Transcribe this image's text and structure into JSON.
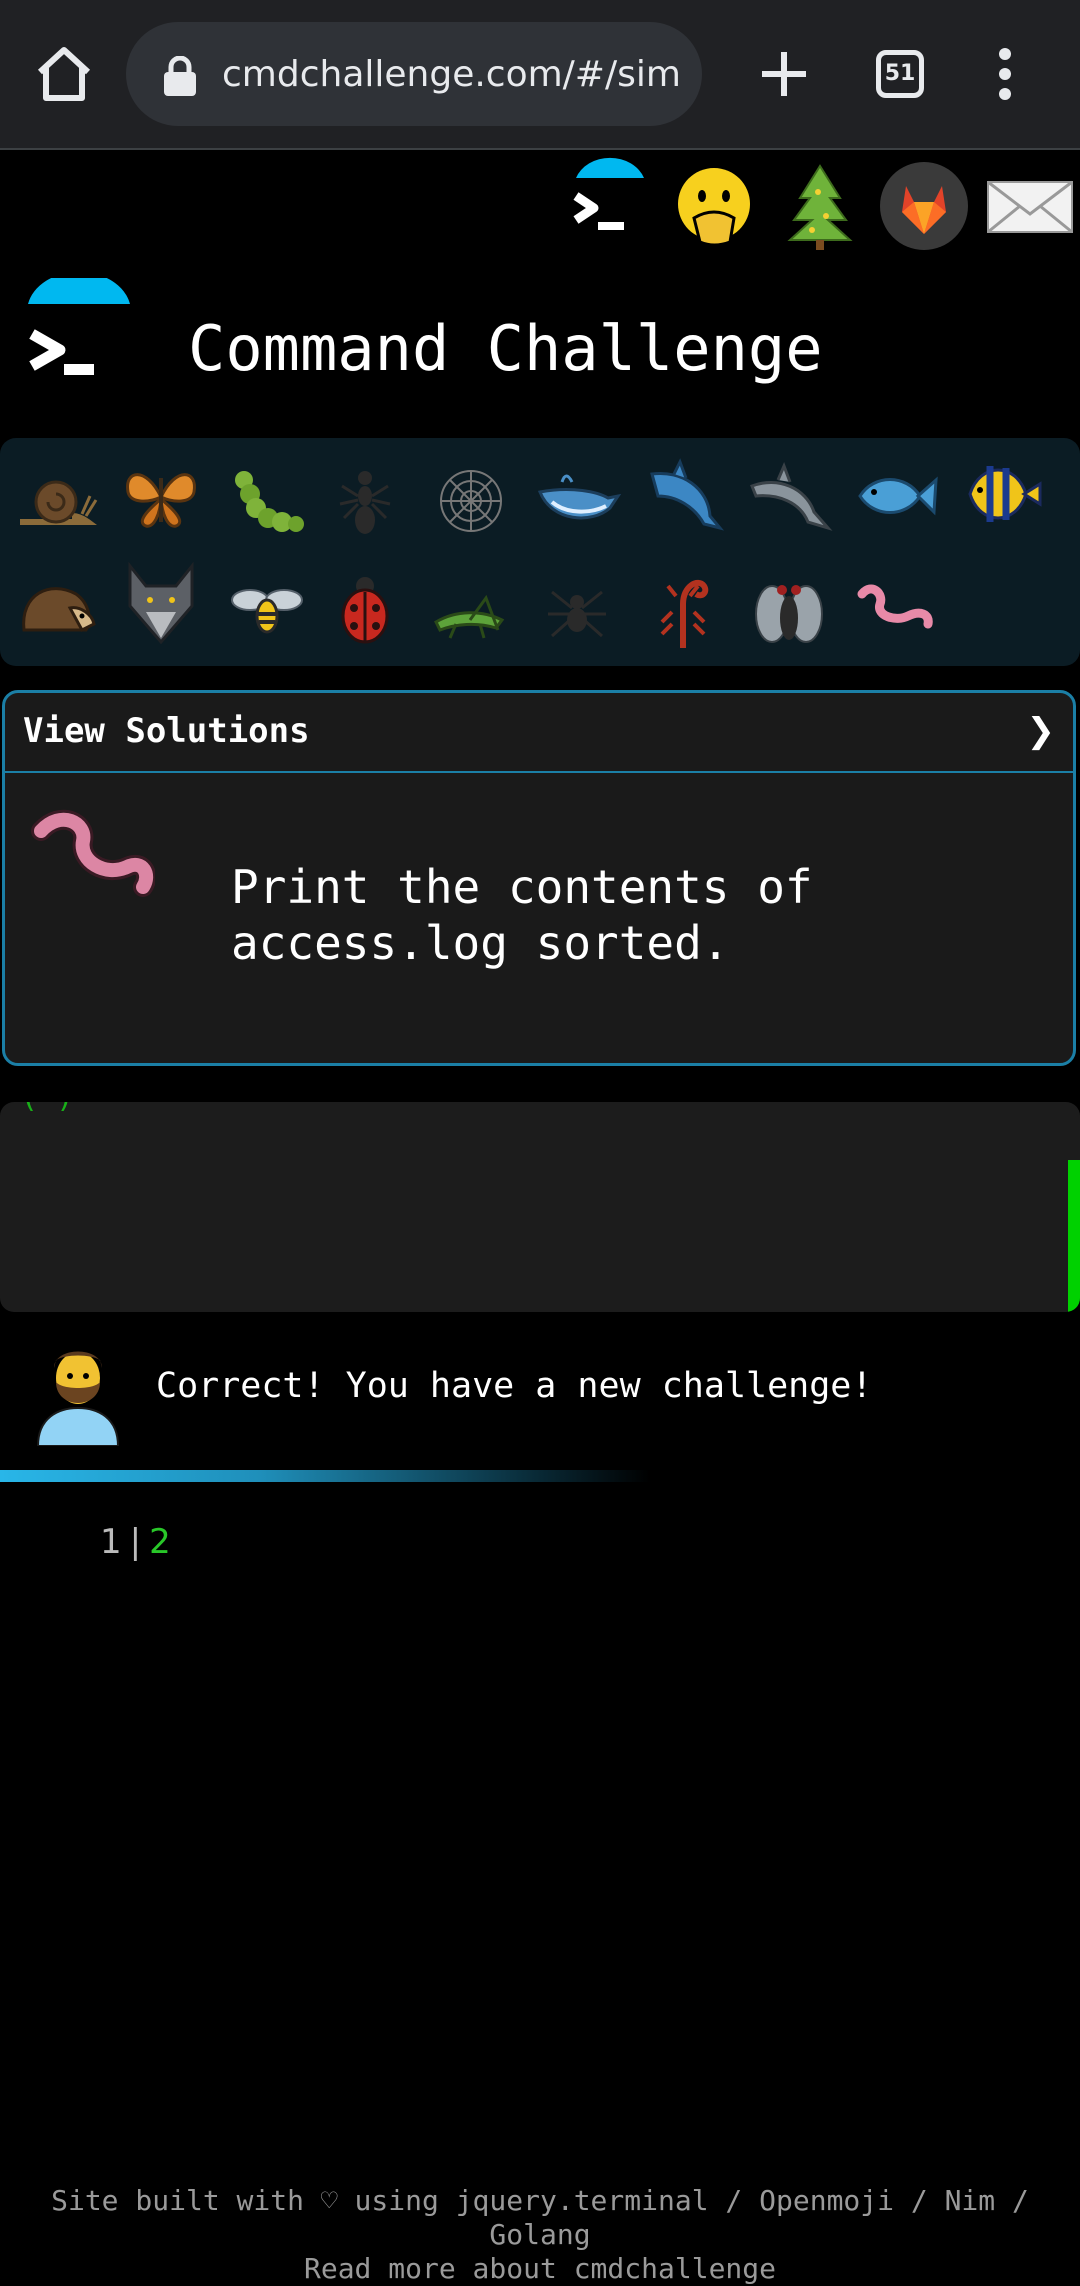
{
  "browser": {
    "url": "cmdchallenge.com/#/simp",
    "tab_count": "51"
  },
  "top_icons": [
    "terminal-icon",
    "face-with-hand-over-mouth-icon",
    "tree-icon",
    "gitlab-icon",
    "envelope-icon"
  ],
  "header": {
    "title": "Command Challenge"
  },
  "animals": {
    "row1": [
      "snail",
      "butterfly",
      "caterpillar",
      "ant",
      "spider-web",
      "whale",
      "dolphin-blue",
      "dolphin-gray",
      "fish",
      "tropical-fish"
    ],
    "row2": [
      "hedgehog",
      "wolf",
      "bee",
      "ladybug",
      "cricket",
      "spider",
      "scorpion",
      "fly",
      "worm"
    ]
  },
  "solutions": {
    "label": "View Solutions",
    "chevron": "❯",
    "challenge_text": "Print the contents of access.log sorted."
  },
  "feedback": {
    "message": "Correct! You have a new challenge!"
  },
  "level": {
    "previous": "1",
    "separator": "|",
    "current": "2"
  },
  "footer": {
    "line1_prefix": "Site built with ♡ using ",
    "link_jquery": "jquery.terminal",
    "sep1": " / ",
    "link_openmoji": "Openmoji",
    "sep2": " / ",
    "link_nim": "Nim",
    "sep3": " / ",
    "link_golang": "Golang",
    "line2": "Read more about cmdchallenge"
  },
  "colors": {
    "accent": "#29b6e8",
    "panel_border": "#1b7fa6",
    "success": "#29c729"
  }
}
